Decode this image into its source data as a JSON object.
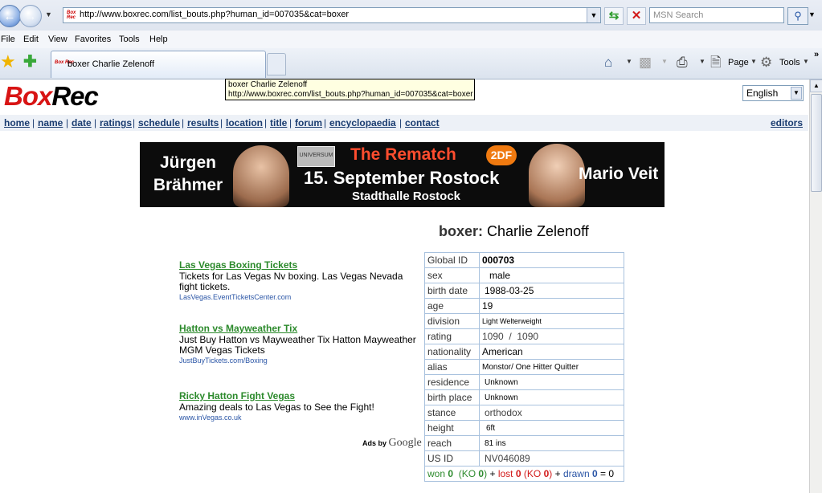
{
  "browser": {
    "url": "http://www.boxrec.com/list_bouts.php?human_id=007035&cat=boxer",
    "search_placeholder": "MSN Search",
    "menu": [
      "File",
      "Edit",
      "View",
      "Favorites",
      "Tools",
      "Help"
    ],
    "tab_title": "boxer Charlie Zelenoff",
    "toolbar": {
      "page_label": "Page",
      "tools_label": "Tools"
    },
    "tooltip": {
      "line1": "boxer Charlie Zelenoff",
      "line2": "http://www.boxrec.com/list_bouts.php?human_id=007035&cat=boxer"
    },
    "favicon_text": "Box Rec"
  },
  "site": {
    "logo_box": "Box",
    "logo_rec": "Rec",
    "language": "English",
    "nav": [
      "home",
      "name",
      "date",
      "ratings",
      "schedule",
      "results",
      "location",
      "title",
      "forum",
      "encyclopaedia",
      "contact"
    ],
    "nav_separator": "|",
    "editors": "editors"
  },
  "banner": {
    "name1_line1": "Jürgen",
    "name1_line2": "Brähmer",
    "title": "The Rematch",
    "zdf": "2DF",
    "date": "15. September Rostock",
    "venue": "Stadthalle Rostock",
    "name2": "Mario Veit",
    "logo_text": "UNIVERSUM"
  },
  "boxer": {
    "label": "boxer:",
    "name": "Charlie Zelenoff"
  },
  "ads": [
    {
      "title": "Las Vegas Boxing Tickets",
      "desc": "Tickets for Las Vegas Nv boxing. Las Vegas Nevada fight tickets.",
      "url": "LasVegas.EventTicketsCenter.com"
    },
    {
      "title": "Hatton vs Mayweather Tix",
      "desc": "Just Buy Hatton vs Mayweather Tix Hatton Mayweather MGM Vegas Tickets",
      "url": "JustBuyTickets.com/Boxing"
    },
    {
      "title": "Ricky Hatton Fight Vegas",
      "desc": "Amazing deals to Las Vegas to See the Fight!",
      "url": "www.inVegas.co.uk"
    }
  ],
  "ads_by": "Ads by",
  "ads_google": "Google",
  "profile": [
    {
      "key": "Global ID",
      "value": "000703"
    },
    {
      "key": "sex",
      "value": "male"
    },
    {
      "key": "birth date",
      "value": "1988-03-25"
    },
    {
      "key": "age",
      "value": "19"
    },
    {
      "key": "division",
      "value": "Light Welterweight"
    },
    {
      "key": "rating",
      "value": "1090  /  1090"
    },
    {
      "key": "nationality",
      "value": "American"
    },
    {
      "key": "alias",
      "value": "Monstor/ One Hitter Quitter"
    },
    {
      "key": "residence",
      "value": "Unknown"
    },
    {
      "key": "birth place",
      "value": "Unknown"
    },
    {
      "key": "stance",
      "value": "orthodox"
    },
    {
      "key": "height",
      "value": "6ft"
    },
    {
      "key": "reach",
      "value": "81 ins"
    },
    {
      "key": "US ID",
      "value": "NV046089"
    }
  ],
  "record": {
    "won_label": "won",
    "won": "0",
    "ko_label": "KO",
    "won_ko": "0",
    "lost_label": "lost",
    "lost": "0",
    "lost_ko": "0",
    "drawn_label": "drawn",
    "drawn": "0",
    "total": "0"
  },
  "colors": {
    "brand_red": "#d81414",
    "link_blue": "#1a3c70",
    "ad_green": "#2c8a2c",
    "won_green": "#2e8b2e",
    "lost_red": "#d21b1b",
    "drawn_blue": "#2a55a6"
  }
}
